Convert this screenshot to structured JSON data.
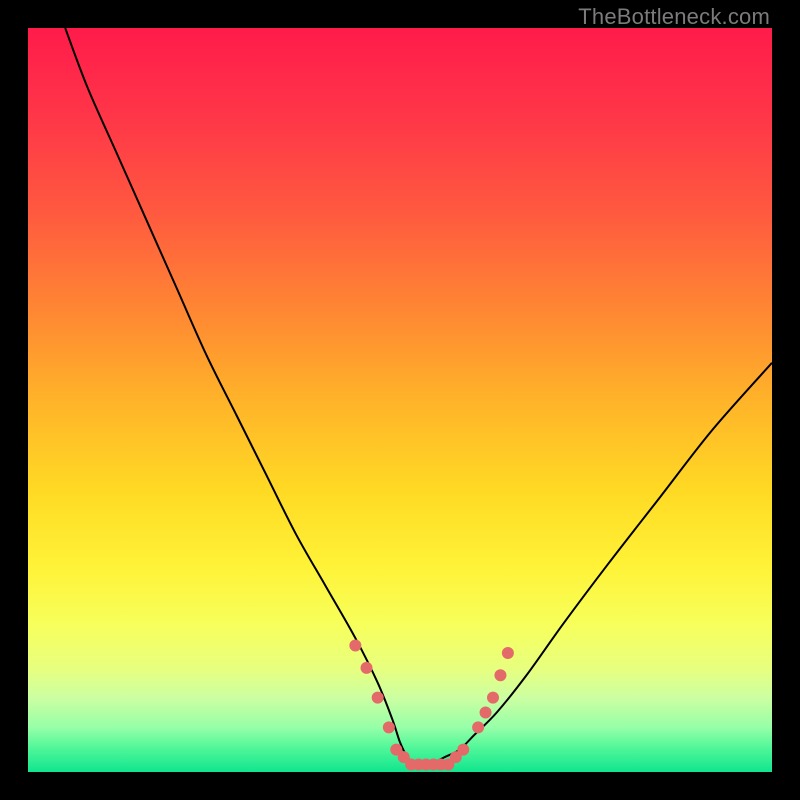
{
  "watermark": "TheBottleneck.com",
  "chart_data": {
    "type": "line",
    "title": "",
    "xlabel": "",
    "ylabel": "",
    "xlim": [
      0,
      100
    ],
    "ylim": [
      0,
      100
    ],
    "background_gradient_stops": [
      {
        "offset": 0.0,
        "color": "#ff1b4b"
      },
      {
        "offset": 0.12,
        "color": "#ff3648"
      },
      {
        "offset": 0.25,
        "color": "#ff5a3f"
      },
      {
        "offset": 0.38,
        "color": "#ff8733"
      },
      {
        "offset": 0.5,
        "color": "#ffb329"
      },
      {
        "offset": 0.62,
        "color": "#ffd924"
      },
      {
        "offset": 0.72,
        "color": "#fff236"
      },
      {
        "offset": 0.8,
        "color": "#f7ff5a"
      },
      {
        "offset": 0.86,
        "color": "#e8ff7e"
      },
      {
        "offset": 0.9,
        "color": "#ccffa1"
      },
      {
        "offset": 0.94,
        "color": "#96ffa8"
      },
      {
        "offset": 0.97,
        "color": "#4bf698"
      },
      {
        "offset": 1.0,
        "color": "#11e58e"
      }
    ],
    "series": [
      {
        "name": "bottleneck-curve",
        "stroke": "#000000",
        "stroke_width": 2,
        "x": [
          5,
          8,
          12,
          16,
          20,
          24,
          28,
          32,
          36,
          40,
          44,
          47,
          49,
          50,
          51,
          52,
          53,
          54,
          56,
          58,
          60,
          63,
          67,
          72,
          78,
          85,
          92,
          100
        ],
        "y": [
          100,
          92,
          83,
          74,
          65,
          56,
          48,
          40,
          32,
          25,
          18,
          12,
          7,
          4,
          2,
          1,
          1,
          1,
          2,
          3,
          5,
          8,
          13,
          20,
          28,
          37,
          46,
          55
        ]
      }
    ],
    "markers": {
      "color": "#e46a6a",
      "radius": 6,
      "points": [
        {
          "x": 44.0,
          "y": 17
        },
        {
          "x": 45.5,
          "y": 14
        },
        {
          "x": 47.0,
          "y": 10
        },
        {
          "x": 48.5,
          "y": 6
        },
        {
          "x": 49.5,
          "y": 3
        },
        {
          "x": 50.5,
          "y": 2
        },
        {
          "x": 51.5,
          "y": 1
        },
        {
          "x": 52.5,
          "y": 1
        },
        {
          "x": 53.5,
          "y": 1
        },
        {
          "x": 54.5,
          "y": 1
        },
        {
          "x": 55.5,
          "y": 1
        },
        {
          "x": 56.5,
          "y": 1
        },
        {
          "x": 57.5,
          "y": 2
        },
        {
          "x": 58.5,
          "y": 3
        },
        {
          "x": 60.5,
          "y": 6
        },
        {
          "x": 61.5,
          "y": 8
        },
        {
          "x": 62.5,
          "y": 10
        },
        {
          "x": 63.5,
          "y": 13
        },
        {
          "x": 64.5,
          "y": 16
        }
      ]
    }
  }
}
